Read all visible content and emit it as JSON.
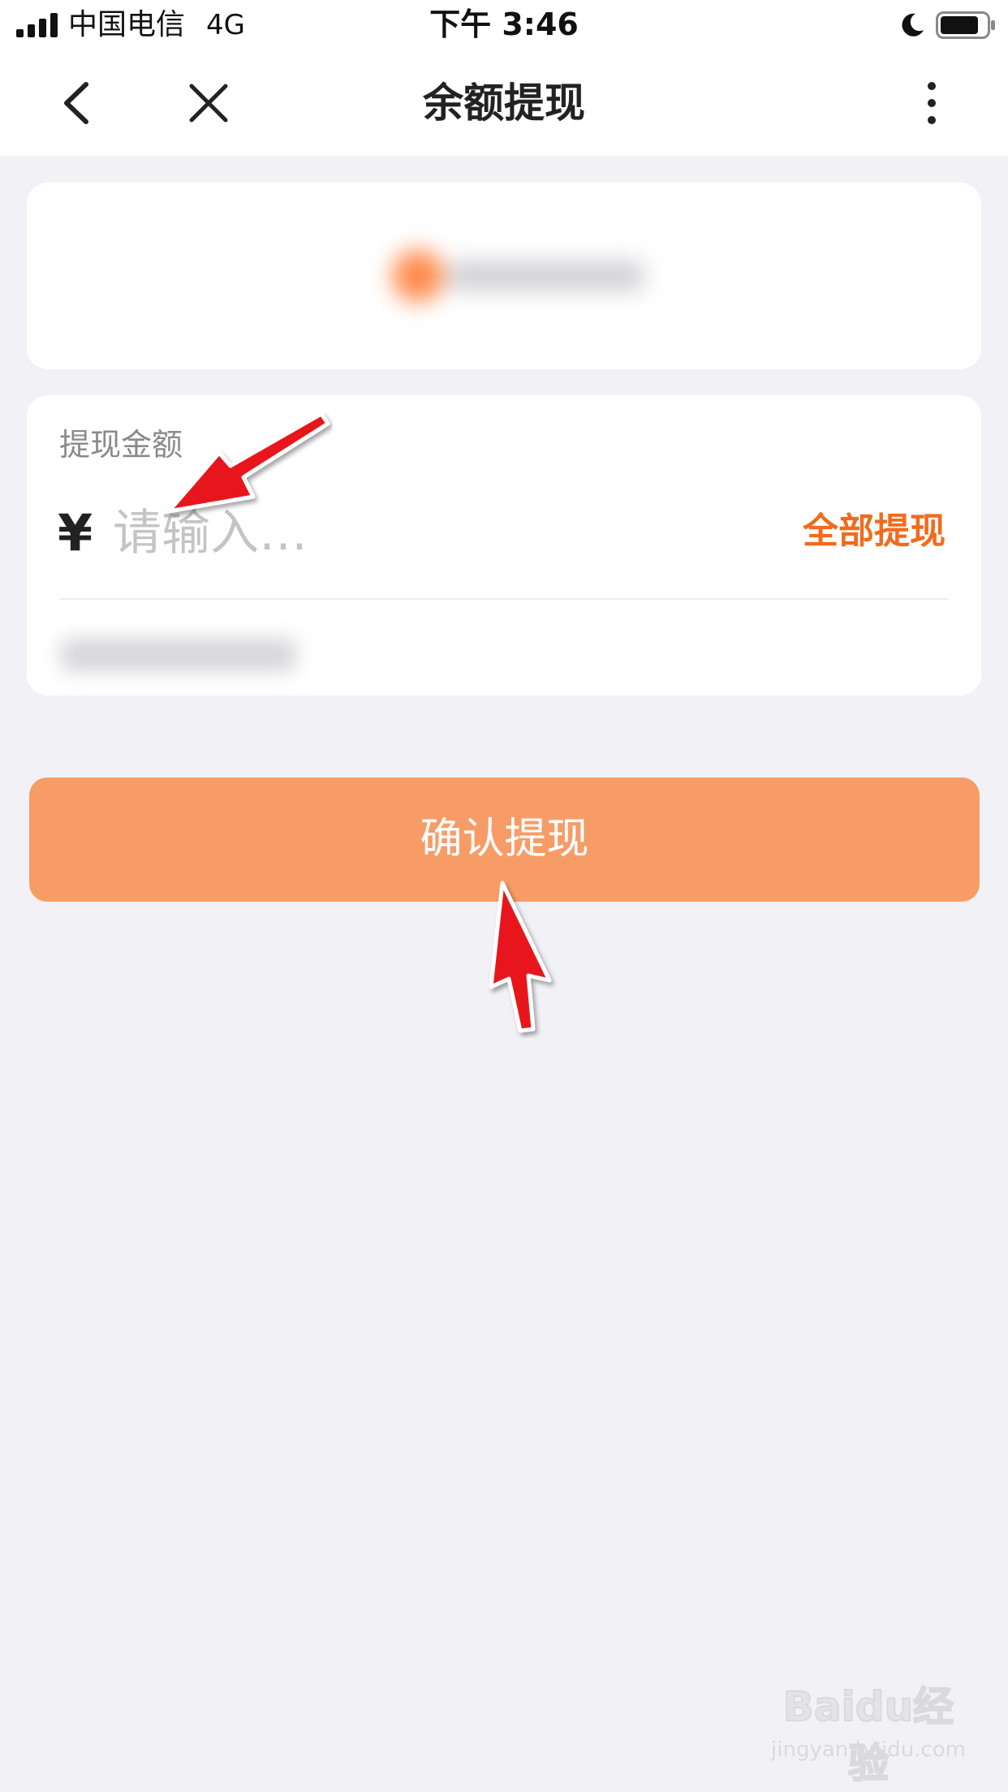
{
  "status_bar": {
    "carrier": "中国电信",
    "network": "4G",
    "time": "下午 3:46"
  },
  "nav_bar": {
    "title": "余额提现",
    "back_icon": "chevron-left-icon",
    "close_icon": "close-icon",
    "more_icon": "more-vertical-icon"
  },
  "withdraw_form": {
    "amount_label": "提现金额",
    "currency_symbol": "¥",
    "amount_value": "",
    "amount_placeholder": "请输入…",
    "withdraw_all_label": "全部提现"
  },
  "confirm_button": {
    "label": "确认提现"
  },
  "watermark": {
    "brand": "Baidu经验",
    "url": "jingyan.baidu.com"
  },
  "colors": {
    "accent_orange": "#f26b1d",
    "button_orange": "#f89c67",
    "page_background": "#f2f2f6",
    "annotation_red": "#e8141b"
  }
}
